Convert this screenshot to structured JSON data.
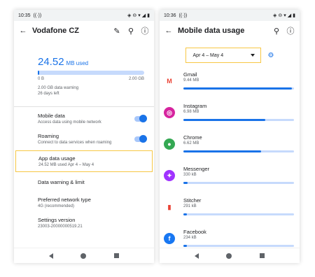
{
  "left": {
    "status": {
      "time": "10:35",
      "extra": "((·))"
    },
    "appbar": {
      "title": "Vodafone CZ"
    },
    "usage": {
      "value": "24.52",
      "unit": "MB used",
      "fraction": 0.012,
      "scale_min": "0 B",
      "scale_max": "2.00 GB",
      "warning": "2.00 GB data warning",
      "days_left": "26 days left"
    },
    "settings": [
      {
        "title": "Mobile data",
        "subtitle": "Access data using mobile network",
        "toggle": true
      },
      {
        "title": "Roaming",
        "subtitle": "Connect to data services when roaming",
        "toggle": true
      },
      {
        "title": "App data usage",
        "subtitle": "24.52 MB used Apr 4 – May 4",
        "highlighted": true
      },
      {
        "title": "Data warning & limit",
        "subtitle": ""
      },
      {
        "title": "Preferred network type",
        "subtitle": "4G (recommended)"
      },
      {
        "title": "Settings version",
        "subtitle": "23003-20000000519.21"
      }
    ]
  },
  "right": {
    "status": {
      "time": "10:36",
      "extra": "((·))"
    },
    "appbar": {
      "title": "Mobile data usage"
    },
    "period": {
      "label": "Apr 4 – May 4"
    },
    "apps": [
      {
        "name": "Gmail",
        "size": "9.44 MB",
        "fraction": 0.98,
        "icon": "gmail-icon",
        "color": "#ffffff",
        "glyph": "M"
      },
      {
        "name": "Instagram",
        "size": "6.98 MB",
        "fraction": 0.74,
        "icon": "instagram-icon",
        "color": "#d6249f",
        "glyph": "◎"
      },
      {
        "name": "Chrome",
        "size": "6.62 MB",
        "fraction": 0.7,
        "icon": "chrome-icon",
        "color": "#34a853",
        "glyph": "●"
      },
      {
        "name": "Messenger",
        "size": "330 kB",
        "fraction": 0.035,
        "icon": "messenger-icon",
        "color": "#a033ff",
        "glyph": "✦"
      },
      {
        "name": "Stitcher",
        "size": "291 kB",
        "fraction": 0.031,
        "icon": "stitcher-icon",
        "color": "#ffffff",
        "glyph": "▮"
      },
      {
        "name": "Facebook",
        "size": "234 kB",
        "fraction": 0.025,
        "icon": "facebook-icon",
        "color": "#1877f2",
        "glyph": "f"
      }
    ]
  }
}
